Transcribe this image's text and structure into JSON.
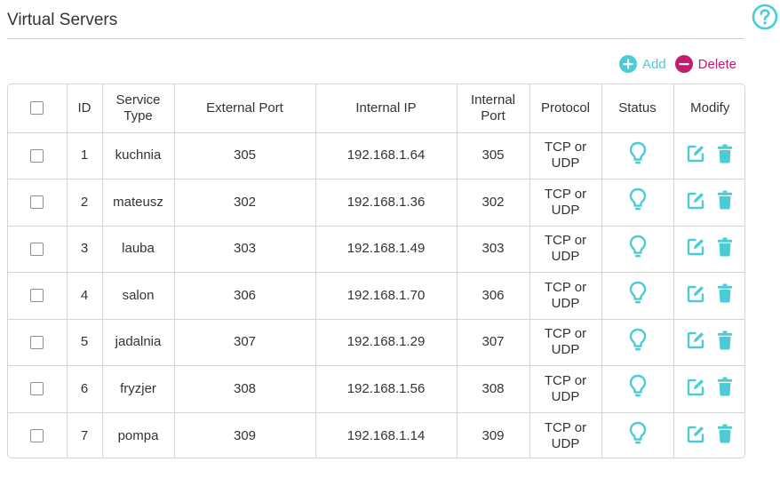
{
  "header": {
    "title": "Virtual Servers",
    "help_icon": "question-circle-icon"
  },
  "toolbar": {
    "add_label": "Add",
    "delete_label": "Delete"
  },
  "colors": {
    "accent": "#4acbd6",
    "delete": "#c01e6b",
    "border": "#d4d4d4",
    "text": "#333333"
  },
  "table": {
    "columns": [
      "ID",
      "Service Type",
      "External Port",
      "Internal IP",
      "Internal Port",
      "Protocol",
      "Status",
      "Modify"
    ],
    "rows": [
      {
        "id": "1",
        "service": "kuchnia",
        "ext_port": "305",
        "int_ip": "192.168.1.64",
        "int_port": "305",
        "protocol": "TCP or UDP"
      },
      {
        "id": "2",
        "service": "mateusz",
        "ext_port": "302",
        "int_ip": "192.168.1.36",
        "int_port": "302",
        "protocol": "TCP or UDP"
      },
      {
        "id": "3",
        "service": "lauba",
        "ext_port": "303",
        "int_ip": "192.168.1.49",
        "int_port": "303",
        "protocol": "TCP or UDP"
      },
      {
        "id": "4",
        "service": "salon",
        "ext_port": "306",
        "int_ip": "192.168.1.70",
        "int_port": "306",
        "protocol": "TCP or UDP"
      },
      {
        "id": "5",
        "service": "jadalnia",
        "ext_port": "307",
        "int_ip": "192.168.1.29",
        "int_port": "307",
        "protocol": "TCP or UDP"
      },
      {
        "id": "6",
        "service": "fryzjer",
        "ext_port": "308",
        "int_ip": "192.168.1.56",
        "int_port": "308",
        "protocol": "TCP or UDP"
      },
      {
        "id": "7",
        "service": "pompa",
        "ext_port": "309",
        "int_ip": "192.168.1.14",
        "int_port": "309",
        "protocol": "TCP or UDP"
      }
    ],
    "icons": {
      "status": "lightbulb-icon",
      "edit": "edit-icon",
      "delete": "trash-icon"
    }
  }
}
